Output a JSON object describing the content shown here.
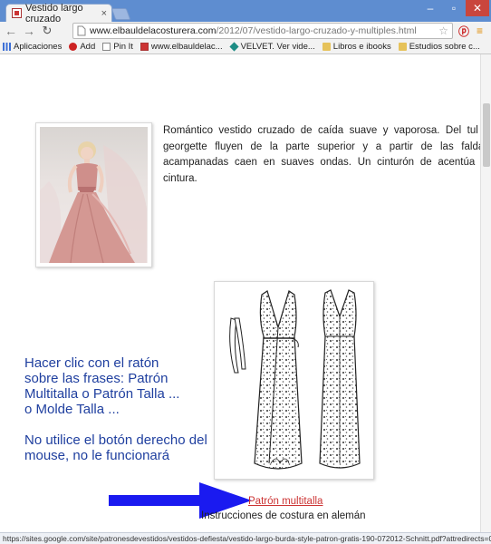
{
  "browser": {
    "tab_title": "Vestido largo cruzado",
    "tab_close": "×",
    "url_host": "www.elbauldelacosturera.com",
    "url_path": "/2012/07/vestido-largo-cruzado-y-multiples.html",
    "status_url": "https://sites.google.com/site/patronesdevestidos/vestidos-defiesta/vestido-largo-burda-style-patron-gratis-190-072012-Schnitt.pdf?attredirects=0",
    "bookmarks": [
      {
        "label": "Aplicaciones",
        "icon": "apps-grid-icon"
      },
      {
        "label": "Add",
        "icon": "pinterest-icon"
      },
      {
        "label": "Pin It",
        "icon": "page-icon"
      },
      {
        "label": "www.elbauldelac...",
        "icon": "site-favicon-icon"
      },
      {
        "label": "VELVET. Ver vide...",
        "icon": "diamond-icon"
      },
      {
        "label": "Libros e ibooks",
        "icon": "folder-icon"
      },
      {
        "label": "Estudios sobre c...",
        "icon": "folder-icon"
      }
    ]
  },
  "post": {
    "description": "Romántico vestido cruzado de caída suave y vaporosa. Del tul y georgette fluyen de la parte superior y a partir de las faldas acampanadas caen en suaves ondas. Un cinturón de acentúa la cintura.",
    "instructions": [
      "Hacer clic con el ratón sobre las frases: Patrón Multitalla o Patrón Talla ... o Molde Talla ...",
      "No utilice el botón derecho del mouse, no le funcionará"
    ],
    "pattern_link": "Patrón multitalla",
    "sewing_text": "Instrucciones de costura en alemán"
  },
  "colors": {
    "tabbar": "#5e8dd0",
    "instruction_text": "#1f3f9f",
    "link": "#cc3333",
    "arrow": "#1a1af0",
    "dress": "#d49893"
  }
}
